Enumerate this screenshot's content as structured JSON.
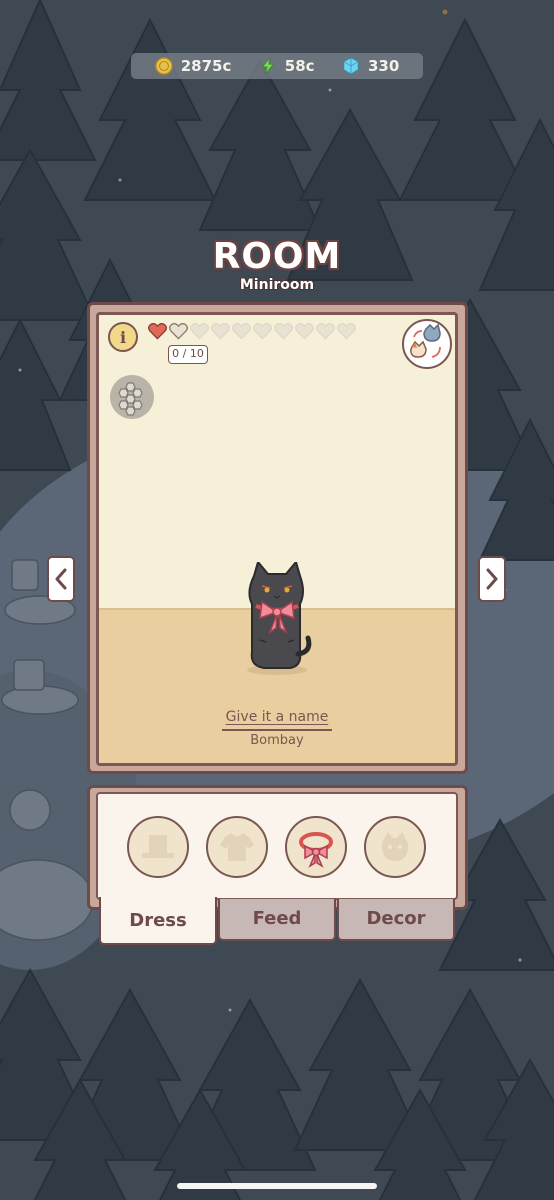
{
  "currency": {
    "coins": "2875c",
    "energy": "58c",
    "gems": "330"
  },
  "room": {
    "title": "ROOM",
    "subtitle": "Miniroom",
    "affection": "0 / 10",
    "affection_filled": 1,
    "affection_total": 10,
    "name_prompt": "Give it a name",
    "breed": "Bombay"
  },
  "tabs": [
    {
      "label": "Dress",
      "active": true
    },
    {
      "label": "Feed",
      "active": false
    },
    {
      "label": "Decor",
      "active": false
    }
  ],
  "dress_slots": [
    "hat-slot-icon",
    "shirt-slot-icon",
    "collar-slot-icon",
    "accessory-slot-icon"
  ],
  "colors": {
    "frame": "#6e4a4a",
    "heart_full": "#e06a5a",
    "heart_empty": "#e8e2d2",
    "energy": "#7ed957",
    "gem": "#6fd3f0",
    "coin": "#e7c14a"
  }
}
